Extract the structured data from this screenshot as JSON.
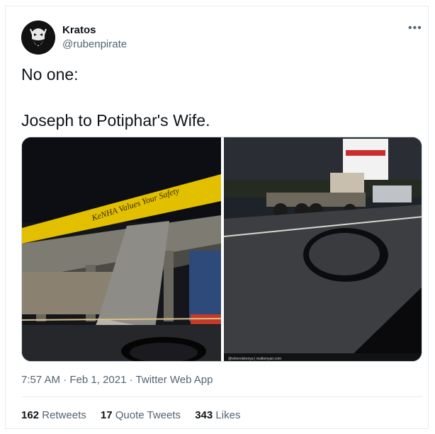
{
  "author": {
    "display_name": "Kratos",
    "handle": "@rubenpirate",
    "avatar_icon": "bearded-warrior-avatar"
  },
  "more_icon": "more-options-icon",
  "tweet": {
    "line1": "No one:",
    "line2": "Joseph to Potiphar's Wife."
  },
  "media": {
    "left_image_sign": "KeNHA Values Your Safety",
    "right_image_watermark": "@whereiskenya | realkenyan.com"
  },
  "meta": {
    "time": "7:57 AM",
    "date": "Feb 1, 2021",
    "source": "Twitter Web App",
    "separator": "·"
  },
  "stats": {
    "retweets_count": "162",
    "retweets_label": "Retweets",
    "quotes_count": "17",
    "quotes_label": "Quote Tweets",
    "likes_count": "343",
    "likes_label": "Likes"
  },
  "colors": {
    "text_primary": "#0f1419",
    "text_secondary": "#536471",
    "border": "#e6ecf0",
    "sign_yellow": "#e2c000"
  }
}
